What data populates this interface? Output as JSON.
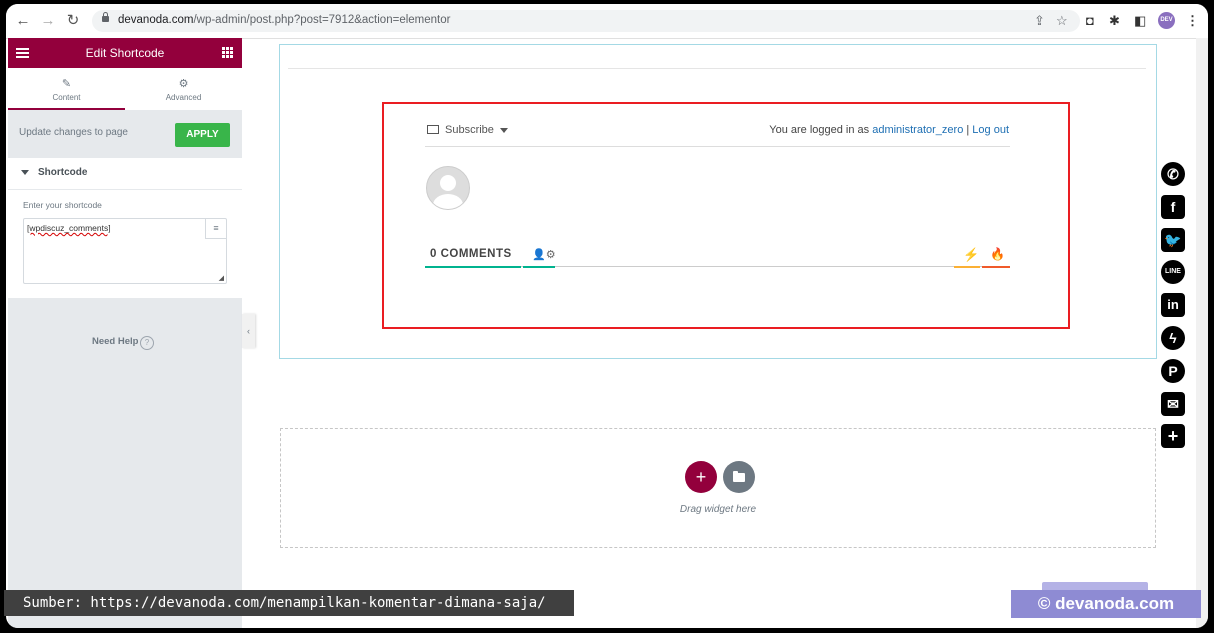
{
  "browser": {
    "url_host": "devanoda.com",
    "url_rest": "/wp-admin/post.php?post=7912&action=elementor",
    "avatar_text": "DEV"
  },
  "panel": {
    "title": "Edit Shortcode",
    "tabs": [
      {
        "label": "Content"
      },
      {
        "label": "Advanced"
      }
    ],
    "update_text": "Update changes to page",
    "apply_label": "APPLY",
    "section_title": "Shortcode",
    "field_label": "Enter your shortcode",
    "shortcode_value": "[wpdiscuz_comments]",
    "need_help": "Need Help"
  },
  "comments": {
    "subscribe_label": "Subscribe",
    "logged_prefix": "You are logged in as",
    "username": "administrator_zero",
    "separator": "|",
    "logout": "Log out",
    "count_label": "0 COMMENTS"
  },
  "dropzone": {
    "text": "Drag widget here"
  },
  "share": [
    "whatsapp-icon",
    "facebook-icon",
    "twitter-icon",
    "line-icon",
    "linkedin-icon",
    "messenger-icon",
    "pinterest-icon",
    "email-icon",
    "more-icon"
  ],
  "overlay": {
    "source": "Sumber: https://devanoda.com/menampilkan-komentar-dimana-saja/",
    "credit": "© devanoda.com"
  },
  "colors": {
    "elementor": "#93003c",
    "apply": "#39b54a",
    "highlight": "#ea1d22"
  }
}
